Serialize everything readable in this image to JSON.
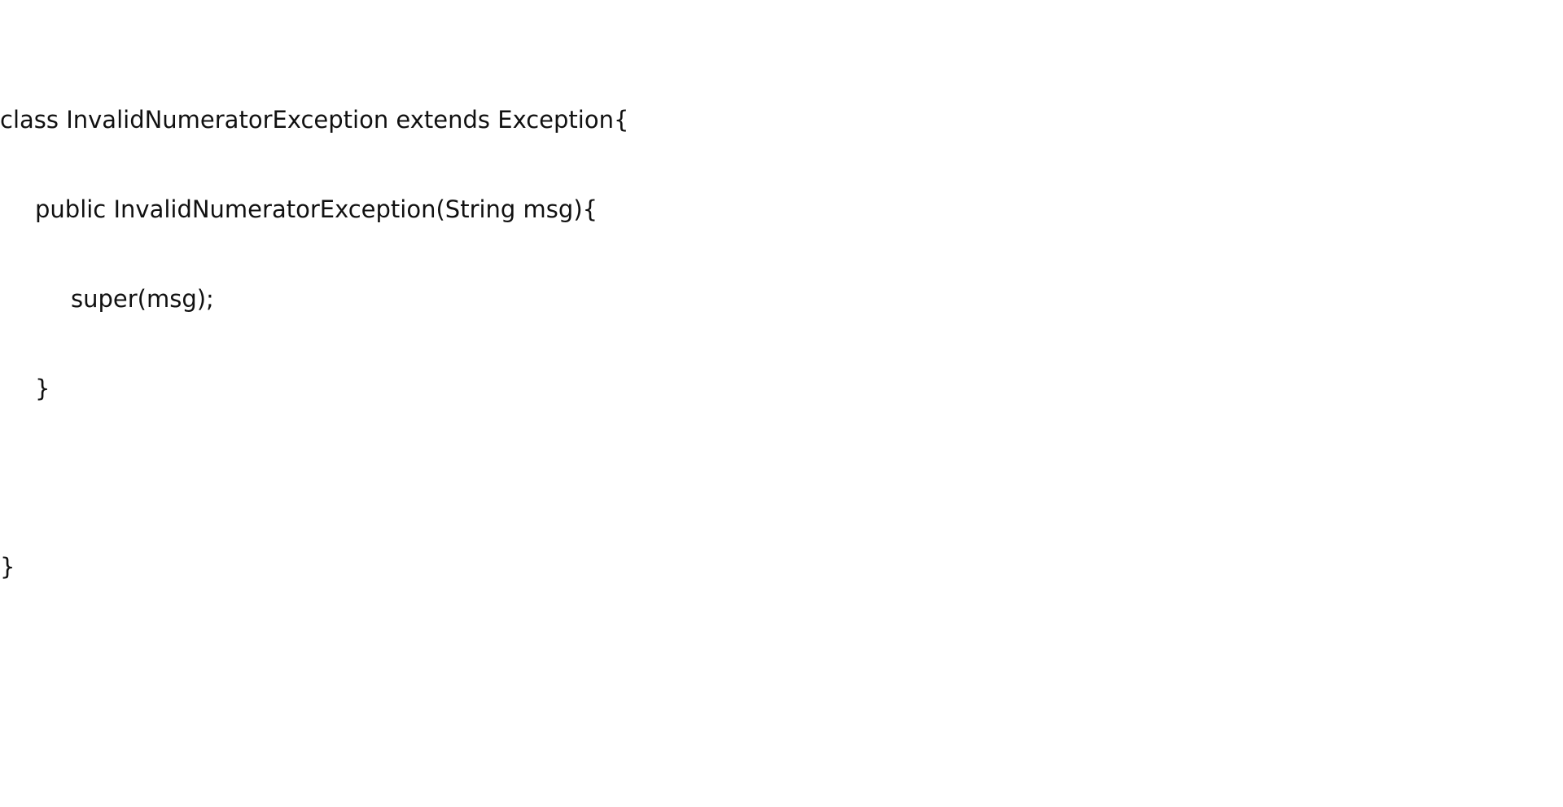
{
  "document": {
    "code_lines": [
      "class InvalidNumeratorException extends Exception{",
      "public InvalidNumeratorException(String msg){",
      "super(msg);",
      "}",
      "",
      "}"
    ]
  },
  "colors": {
    "background": "#ffffff",
    "text": "#111111"
  }
}
